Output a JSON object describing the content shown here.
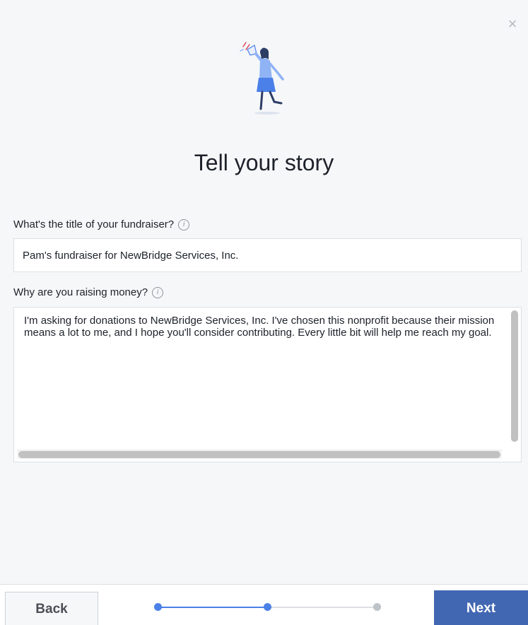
{
  "dialog": {
    "close_symbol": "×",
    "heading": "Tell your story"
  },
  "title_field": {
    "label": "What's the title of your fundraiser?",
    "info_symbol": "i",
    "value": "Pam's fundraiser for NewBridge Services, Inc."
  },
  "story_field": {
    "label": "Why are you raising money?",
    "info_symbol": "i",
    "value": "I'm asking for donations to NewBridge Services, Inc. I've chosen this nonprofit because their mission means a lot to me, and I hope you'll consider contributing. Every little bit will help me reach my goal."
  },
  "footer": {
    "back_label": "Back",
    "next_label": "Next",
    "steps_total": 3,
    "current_step": 2
  },
  "colors": {
    "accent": "#4267b2",
    "step_active": "#4a80e8",
    "step_inactive": "#dddfe2",
    "step_dot_inactive": "#bec3c9"
  },
  "icons": {
    "close": "close-icon",
    "info": "info-icon",
    "illustration": "person-with-megaphone-illustration"
  }
}
